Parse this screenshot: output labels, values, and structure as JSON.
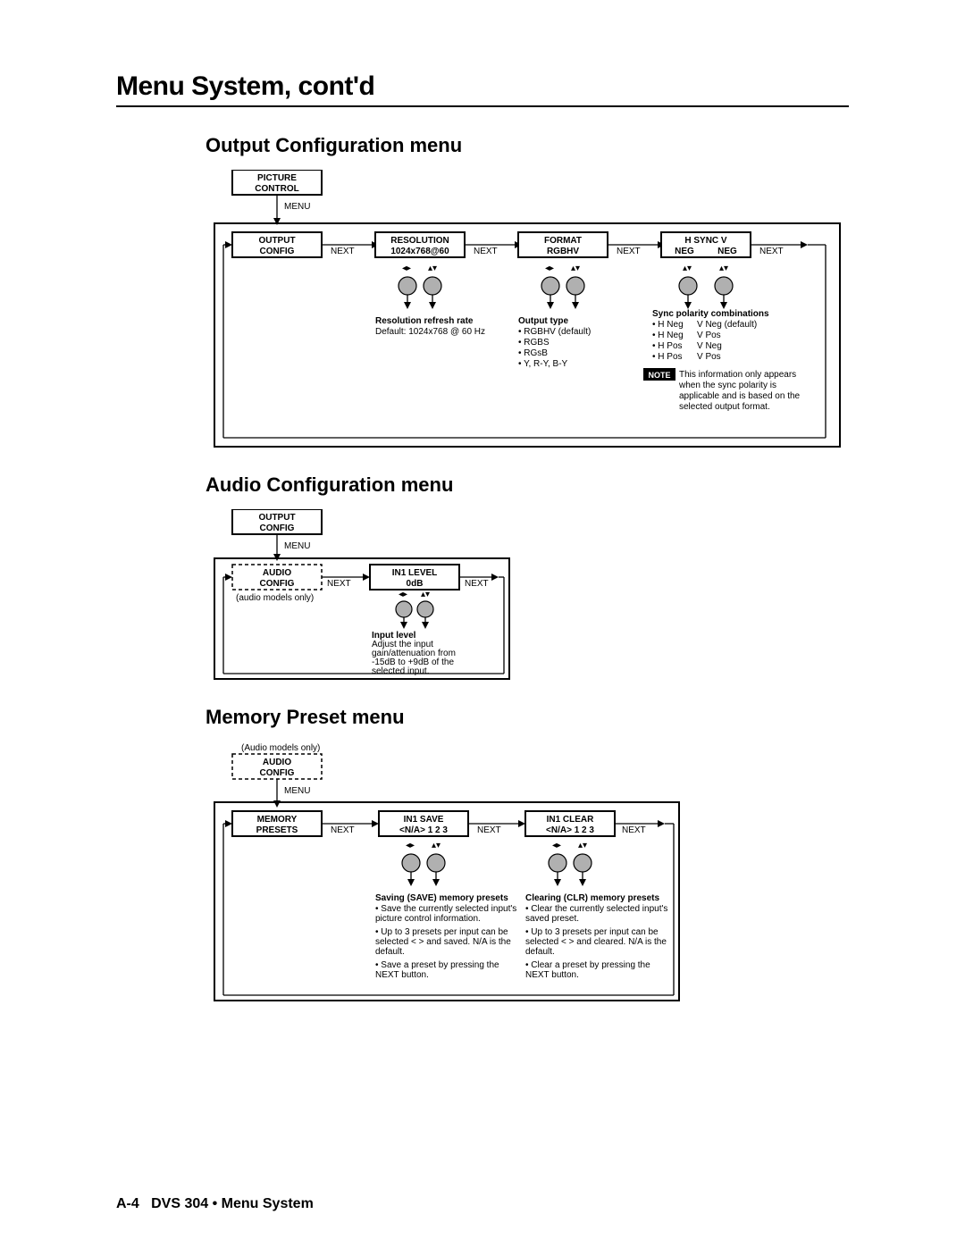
{
  "page": {
    "title": "Menu System, cont'd",
    "footer_page": "A-4",
    "footer_text": "DVS 304 • Menu System"
  },
  "sections": {
    "output": {
      "title": "Output Configuration menu"
    },
    "audio": {
      "title": "Audio Configuration menu"
    },
    "memory": {
      "title": "Memory Preset menu"
    }
  },
  "d1": {
    "prev_box_l1": "PICTURE",
    "prev_box_l2": "CONTROL",
    "menu_arrow": "MENU",
    "next": "NEXT",
    "b1_l1": "OUTPUT",
    "b1_l2": "CONFIG",
    "b2_l1": "RESOLUTION",
    "b2_l2": "1024x768@60",
    "b3_l1": "FORMAT",
    "b3_l2": "RGBHV",
    "b4_l1": "H SYNC V",
    "b4_l2l": "NEG",
    "b4_l2r": "NEG",
    "note2_h": "Resolution refresh rate",
    "note2_1": "Default: 1024x768 @ 60 Hz",
    "note3_h": "Output type",
    "note3_1": "RGBHV (default)",
    "note3_2": "RGBS",
    "note3_3": "RGsB",
    "note3_4": "Y, R-Y, B-Y",
    "note4_h": "Sync polarity combinations",
    "note4_1l": "H Neg",
    "note4_1r": "V Neg  (default)",
    "note4_2l": "H Neg",
    "note4_2r": "V Pos",
    "note4_3l": "H Pos",
    "note4_3r": "V Neg",
    "note4_4l": "H Pos",
    "note4_4r": "V Pos",
    "note_badge": "NOTE",
    "note_foot1": "This information only appears",
    "note_foot2": "when the sync polarity is",
    "note_foot3": "applicable and is based on the",
    "note_foot4": "selected output format."
  },
  "d2": {
    "prev_box_l1": "OUTPUT",
    "prev_box_l2": "CONFIG",
    "menu_arrow": "MENU",
    "b1_l1": "AUDIO",
    "b1_l2": "CONFIG",
    "sub": "(audio models only)",
    "b2_l1": "IN1  LEVEL",
    "b2_l2": "0dB",
    "next": "NEXT",
    "note_h": "Input level",
    "note_1": "Adjust the input",
    "note_2": "gain/attenuation from",
    "note_3": "-15dB to +9dB of the",
    "note_4": "selected input."
  },
  "d3": {
    "top_note": "(Audio models only)",
    "prev_box_l1": "AUDIO",
    "prev_box_l2": "CONFIG",
    "menu_arrow": "MENU",
    "b1_l1": "MEMORY",
    "b1_l2": "PRESETS",
    "b2_l1": "IN1  SAVE",
    "b2_l2": "<N/A> 1 2 3",
    "b3_l1": "IN1  CLEAR",
    "b3_l2": "<N/A> 1 2 3",
    "next": "NEXT",
    "save_h": "Saving (SAVE) memory presets",
    "save_1": "Save the currently selected input's picture control information.",
    "save_2": "Up to 3 presets per input can be selected < > and saved. N/A is the default.",
    "save_3": "Save a preset by pressing the NEXT button.",
    "clr_h": "Clearing (CLR) memory presets",
    "clr_1": "Clear the currently selected input's saved preset.",
    "clr_2": "Up to 3 presets per input can be selected < > and cleared. N/A is the default.",
    "clr_3": "Clear a preset by pressing the NEXT button."
  }
}
